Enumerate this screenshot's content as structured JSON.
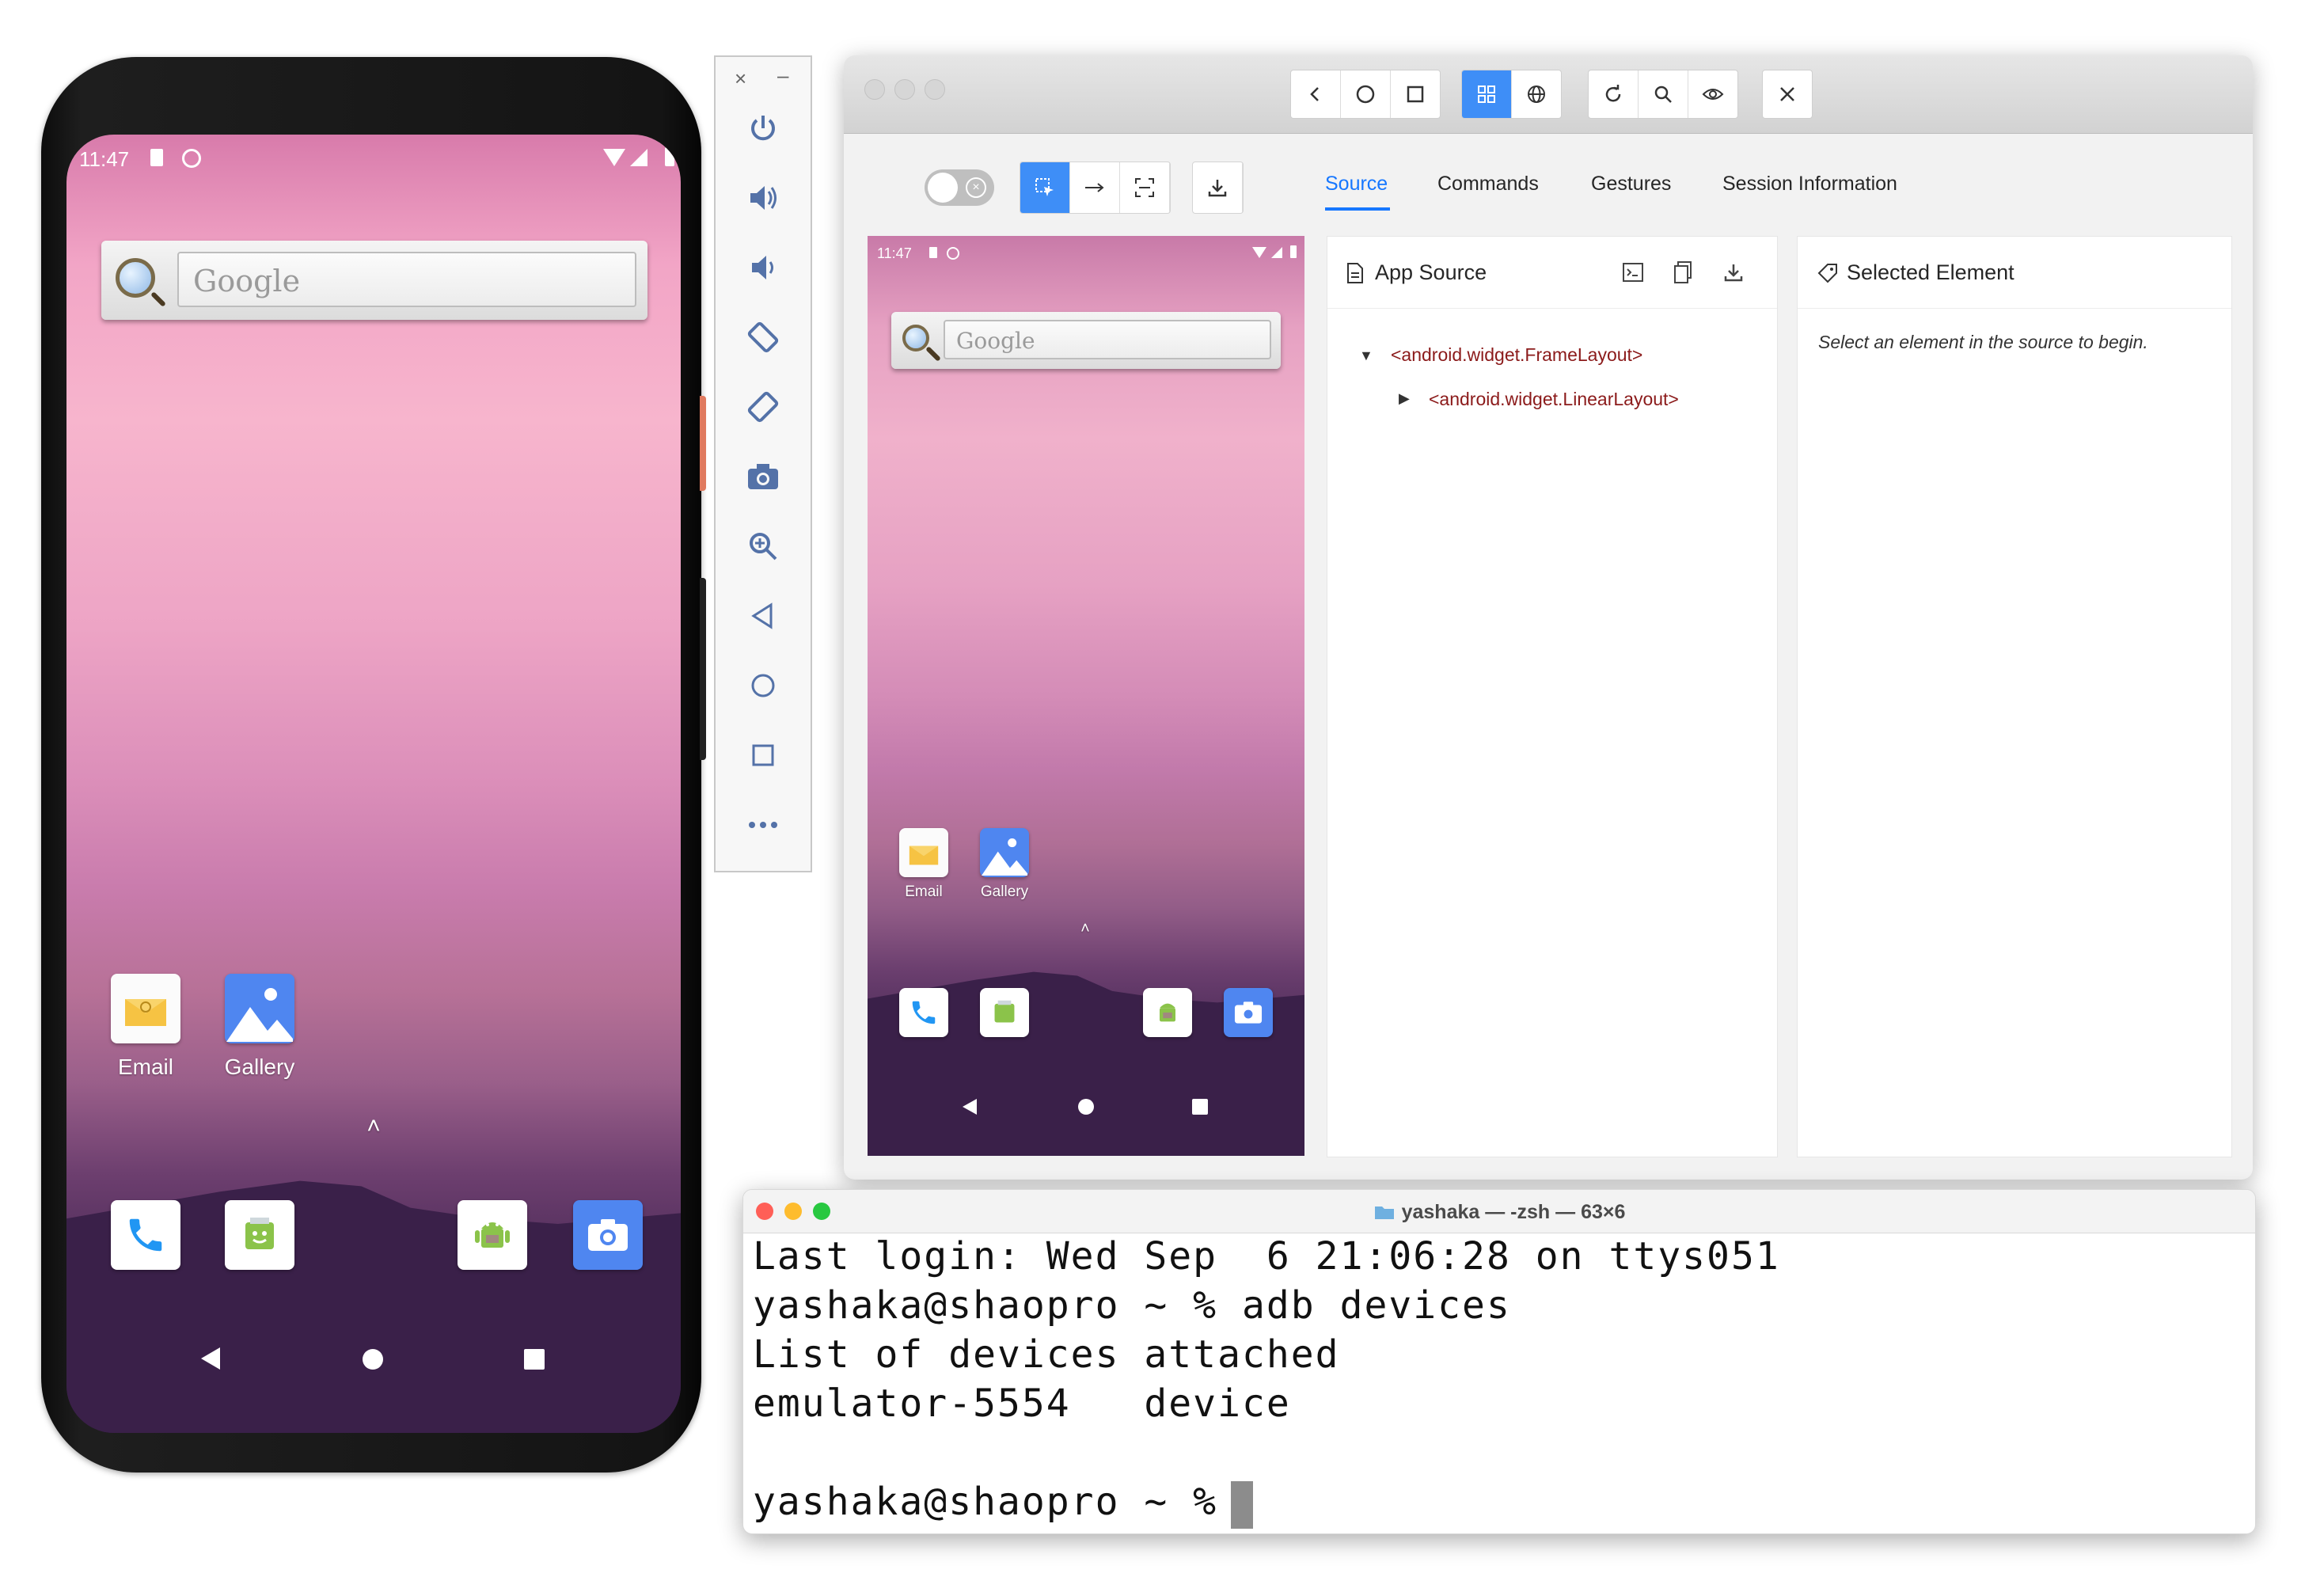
{
  "phone": {
    "status_time": "11:47",
    "search_placeholder": "Google",
    "apps": [
      {
        "label": "Email"
      },
      {
        "label": "Gallery"
      }
    ],
    "drawer_arrow": "˄",
    "dock_icons": [
      "phone-icon",
      "messaging-icon",
      "android-icon",
      "camera-icon"
    ],
    "nav": [
      "back",
      "home",
      "recents"
    ]
  },
  "emulator_toolbar": {
    "close": "×",
    "minimize": "–",
    "buttons": [
      "power",
      "volume-up",
      "volume-down",
      "rotate-left",
      "rotate-right",
      "screenshot",
      "zoom",
      "back",
      "home",
      "overview",
      "more"
    ]
  },
  "inspector": {
    "tabs": [
      {
        "label": "Source",
        "active": true
      },
      {
        "label": "Commands"
      },
      {
        "label": "Gestures"
      },
      {
        "label": "Session Information"
      }
    ],
    "device": {
      "status_time": "11:47",
      "search_placeholder": "Google",
      "apps": [
        {
          "label": "Email"
        },
        {
          "label": "Gallery"
        }
      ]
    },
    "app_source": {
      "title": "App Source",
      "nodes": [
        {
          "text": "<android.widget.FrameLayout>",
          "expanded": true
        },
        {
          "text": "<android.widget.LinearLayout>",
          "expanded": false
        }
      ]
    },
    "selected_element": {
      "title": "Selected Element",
      "hint": "Select an element in the source to begin."
    },
    "accent": "#1677ff"
  },
  "terminal": {
    "title": "yashaka — -zsh — 63×6",
    "lines": [
      "Last login: Wed Sep  6 21:06:28 on ttys051",
      "yashaka@shaopro ~ % adb devices",
      "List of devices attached",
      "emulator-5554   device",
      "",
      "yashaka@shaopro ~ % "
    ]
  }
}
